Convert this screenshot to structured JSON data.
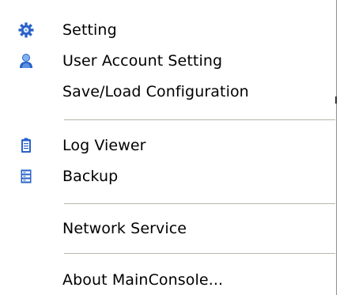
{
  "menu": {
    "items": [
      {
        "label": "Setting",
        "icon": "gear-icon"
      },
      {
        "label": "User Account Setting",
        "icon": "user-icon"
      },
      {
        "label": "Save/Load Configuration",
        "icon": ""
      },
      {
        "label": "Log Viewer",
        "icon": "clipboard-icon"
      },
      {
        "label": "Backup",
        "icon": "backup-icon"
      },
      {
        "label": "Network Service",
        "icon": ""
      },
      {
        "label": "About MainConsole...",
        "icon": ""
      }
    ]
  },
  "colors": {
    "icon_blue": "#2a62c9",
    "icon_light_blue": "#7fb3f0",
    "separator": "#b8b7a9",
    "text": "#000000"
  }
}
